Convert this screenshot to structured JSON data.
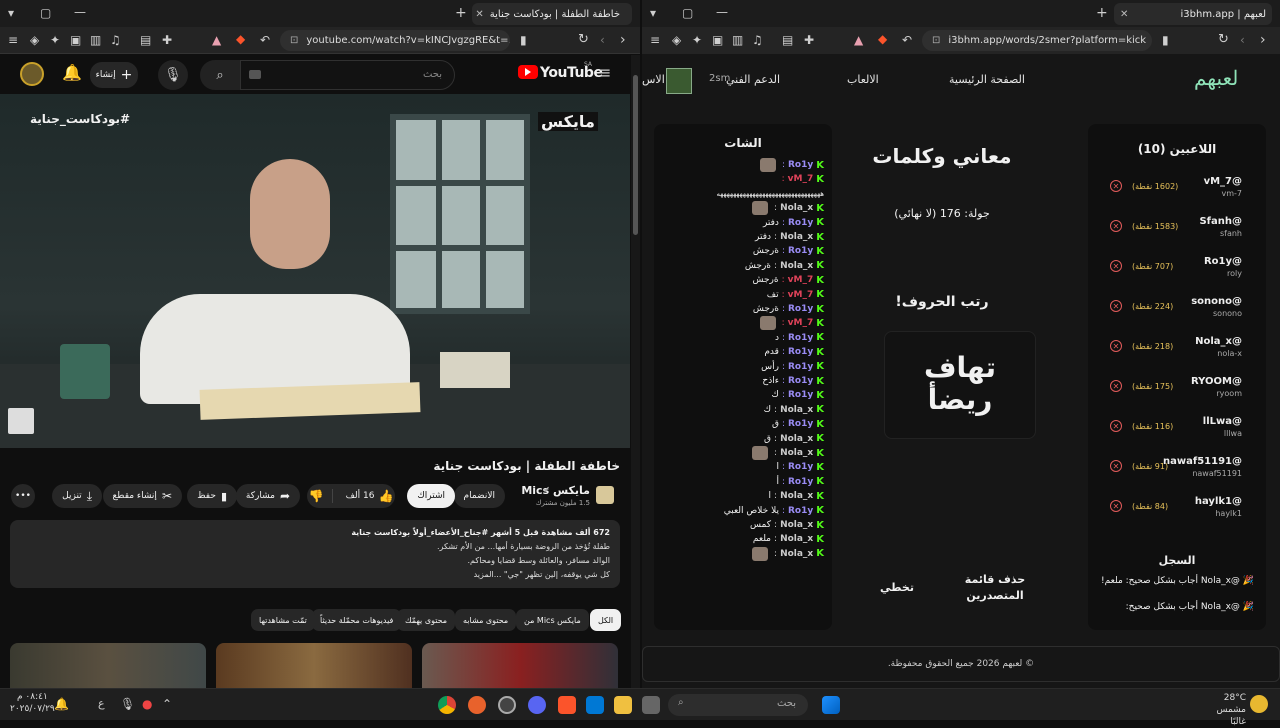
{
  "left_browser": {
    "tab_title": "خاطفة الطفلة | بودكاست جناية",
    "url": "youtube.com/watch?v=kINCJvgzgRE&t=1...",
    "yt": {
      "logo": "YouTube",
      "region": "SA",
      "search_placeholder": "بحث",
      "create_label": "إنشاء"
    },
    "video": {
      "hashtag": "#بودكاست_جناية",
      "watermark": "مايكس",
      "title": "خاطفة الطفلة | بودكاست جناية"
    },
    "channel": {
      "name": "مايكس Mics",
      "subs": "1.5 مليون مشترك",
      "join": "الانضمام",
      "subscribe": "اشتراك"
    },
    "actions": {
      "likes": "16 ألف",
      "share": "مشاركة",
      "save": "حفظ",
      "clip": "إنشاء مقطع",
      "download": "تنزيل"
    },
    "description": {
      "stats": "672 ألف مشاهدة  قبل 5 أشهر  #جناح_الأعضاء_أولاً  بودكاست جناية",
      "line1": "طفلة تُؤخذ من الروضة بسيارة أمها... من الأم تشكر.",
      "line2": "الوالد مسافر، والعائلة وسط قضايا ومحاكم.",
      "line3": "كل شي يوقفه، إلين تظهر \"جي\"  ...المزيد"
    },
    "chips": [
      "الكل",
      "من Mics مايكس",
      "محتوى مشابه",
      "محتوى يهمّك",
      "فيديوهات محمّلة حديثاً",
      "تمّت مشاهدتها"
    ]
  },
  "right_browser": {
    "tab_title": "لعبهم | i3bhm.app",
    "url": "i3bhm.app/words/2smer?platform=kick",
    "site": {
      "logo": "لعبهم",
      "nav": [
        "الصفحة الرئيسية",
        "الالعاب",
        "الدعم الفني",
        "الاس"
      ],
      "user": "2sm",
      "players_title": "اللاعبين (10)",
      "players": [
        {
          "name": "@vM_7",
          "user": "vm-7",
          "points": "(1602 نقطة)"
        },
        {
          "name": "@Sfanh",
          "user": "sfanh",
          "points": "(1583 نقطة)"
        },
        {
          "name": "@Ro1y",
          "user": "roly",
          "points": "(707 نقطة)"
        },
        {
          "name": "@sonono",
          "user": "sonono",
          "points": "(224 نقطة)"
        },
        {
          "name": "@Nola_x",
          "user": "nola-x",
          "points": "(218 نقطة)"
        },
        {
          "name": "@RYOOM",
          "user": "ryoom",
          "points": "(175 نقطة)"
        },
        {
          "name": "@llLwa",
          "user": "lllwa",
          "points": "(116 نقطة)"
        },
        {
          "name": "@nawaf51191",
          "user": "nawaf51191",
          "points": "(91 نقطة)"
        },
        {
          "name": "@haylk1",
          "user": "haylk1",
          "points": "(84 نقطة)"
        }
      ],
      "log_title": "السجل",
      "log": [
        "@Nola_x أجاب بشكل صحيح: ملعم!",
        "@Nola_x أجاب بشكل صحيح:"
      ],
      "game_title": "معاني وكلمات",
      "round": "جولة: 176 (لا نهائي)",
      "instruction": "رتب الحروف!",
      "scrambled1": "تهاف",
      "scrambled2": "ريضأ",
      "delete_list": "حذف قائمة المتصدرين",
      "skip": "تخطي",
      "chat_title": "الشات",
      "chat": [
        {
          "user": "Ro1y",
          "msg": "",
          "color": "#9a8cf5",
          "emote": true
        },
        {
          "user": "vM_7",
          "msg": "",
          "color": "#e0435a"
        },
        {
          "user": "",
          "msg": "ههههههههههههههههههههههههههههههههه",
          "color": "#ffffff"
        },
        {
          "user": "Nola_x",
          "msg": "",
          "color": "#cccccc",
          "emote": true
        },
        {
          "user": "Ro1y",
          "msg": "دفتر",
          "color": "#9a8cf5"
        },
        {
          "user": "Nola_x",
          "msg": "دفتر",
          "color": "#cccccc"
        },
        {
          "user": "Ro1y",
          "msg": "ةرجش",
          "color": "#9a8cf5"
        },
        {
          "user": "Nola_x",
          "msg": "ةرجش",
          "color": "#cccccc"
        },
        {
          "user": "vM_7",
          "msg": "ةرجش",
          "color": "#e0435a"
        },
        {
          "user": "vM_7",
          "msg": "تف",
          "color": "#e0435a"
        },
        {
          "user": "Ro1y",
          "msg": "ةرجش",
          "color": "#9a8cf5"
        },
        {
          "user": "vM_7",
          "msg": "",
          "color": "#e0435a",
          "emote": true
        },
        {
          "user": "Ro1y",
          "msg": "د",
          "color": "#9a8cf5"
        },
        {
          "user": "Ro1y",
          "msg": "قدم",
          "color": "#9a8cf5"
        },
        {
          "user": "Ro1y",
          "msg": "رأس",
          "color": "#9a8cf5"
        },
        {
          "user": "Ro1y",
          "msg": "ءاذح",
          "color": "#9a8cf5"
        },
        {
          "user": "Ro1y",
          "msg": "ك",
          "color": "#9a8cf5"
        },
        {
          "user": "Nola_x",
          "msg": "ك",
          "color": "#cccccc"
        },
        {
          "user": "Ro1y",
          "msg": "ق",
          "color": "#9a8cf5"
        },
        {
          "user": "Nola_x",
          "msg": "ق",
          "color": "#cccccc"
        },
        {
          "user": "Nola_x",
          "msg": "",
          "color": "#cccccc",
          "emote": true
        },
        {
          "user": "Ro1y",
          "msg": "ا",
          "color": "#9a8cf5"
        },
        {
          "user": "Ro1y",
          "msg": "أ",
          "color": "#9a8cf5"
        },
        {
          "user": "Nola_x",
          "msg": "ا",
          "color": "#cccccc"
        },
        {
          "user": "Ro1y",
          "msg": "يلا خلاص العبي",
          "color": "#9a8cf5"
        },
        {
          "user": "Nola_x",
          "msg": "كمس",
          "color": "#cccccc"
        },
        {
          "user": "Nola_x",
          "msg": "ملعم",
          "color": "#cccccc"
        },
        {
          "user": "Nola_x",
          "msg": "",
          "color": "#cccccc",
          "emote": true
        }
      ],
      "footer": "© لعبهم 2026 جميع الحقوق محفوظة."
    }
  },
  "taskbar": {
    "search": "بحث",
    "weather_temp": "28°C",
    "weather_desc": "مشمس غالبًا",
    "time": "٠٨:٤١ م",
    "date": "٢٠٢٥/٠٧/٢٩",
    "lang": "ع"
  }
}
